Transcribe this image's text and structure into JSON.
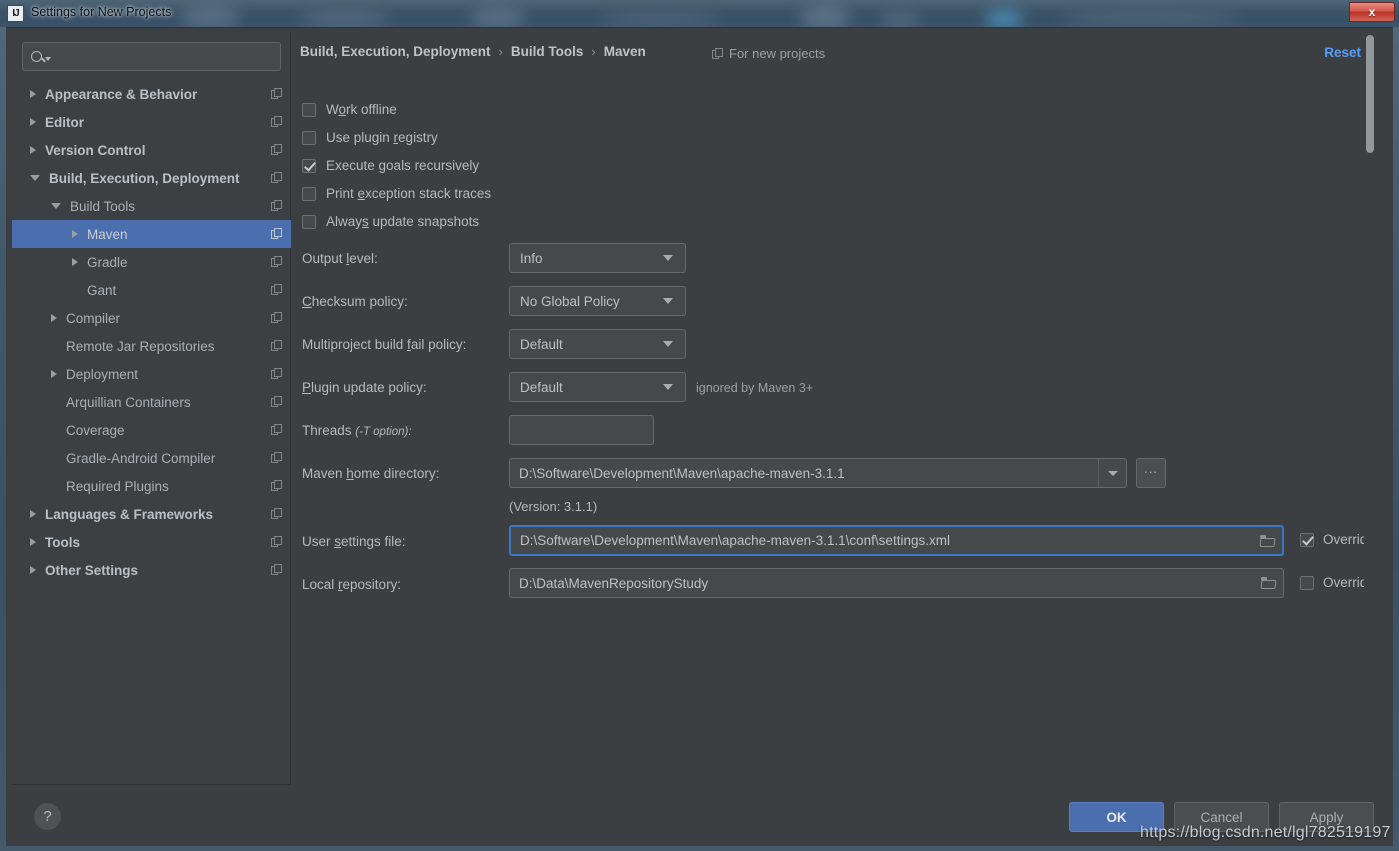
{
  "window": {
    "title": "Settings for New Projects",
    "app_icon": "IJ",
    "close_label": "x"
  },
  "sidebar": {
    "search": {
      "placeholder": "",
      "value": "",
      "icon": "search-icon"
    },
    "tree": [
      {
        "label": "Appearance & Behavior",
        "indent": 0,
        "state": "collapsed",
        "bold": true,
        "selected": false
      },
      {
        "label": "Editor",
        "indent": 0,
        "state": "collapsed",
        "bold": true,
        "selected": false
      },
      {
        "label": "Version Control",
        "indent": 0,
        "state": "collapsed",
        "bold": true,
        "selected": false
      },
      {
        "label": "Build, Execution, Deployment",
        "indent": 0,
        "state": "expanded",
        "bold": true,
        "selected": false
      },
      {
        "label": "Build Tools",
        "indent": 1,
        "state": "expanded",
        "bold": false,
        "selected": false
      },
      {
        "label": "Maven",
        "indent": 2,
        "state": "collapsed",
        "bold": false,
        "selected": true
      },
      {
        "label": "Gradle",
        "indent": 2,
        "state": "collapsed",
        "bold": false,
        "selected": false
      },
      {
        "label": "Gant",
        "indent": 2,
        "state": "leaf",
        "bold": false,
        "selected": false
      },
      {
        "label": "Compiler",
        "indent": 1,
        "state": "collapsed",
        "bold": false,
        "selected": false
      },
      {
        "label": "Remote Jar Repositories",
        "indent": 1,
        "state": "leaf",
        "bold": false,
        "selected": false
      },
      {
        "label": "Deployment",
        "indent": 1,
        "state": "collapsed",
        "bold": false,
        "selected": false
      },
      {
        "label": "Arquillian Containers",
        "indent": 1,
        "state": "leaf",
        "bold": false,
        "selected": false
      },
      {
        "label": "Coverage",
        "indent": 1,
        "state": "leaf",
        "bold": false,
        "selected": false
      },
      {
        "label": "Gradle-Android Compiler",
        "indent": 1,
        "state": "leaf",
        "bold": false,
        "selected": false
      },
      {
        "label": "Required Plugins",
        "indent": 1,
        "state": "leaf",
        "bold": false,
        "selected": false
      },
      {
        "label": "Languages & Frameworks",
        "indent": 0,
        "state": "collapsed",
        "bold": true,
        "selected": false
      },
      {
        "label": "Tools",
        "indent": 0,
        "state": "collapsed",
        "bold": true,
        "selected": false
      },
      {
        "label": "Other Settings",
        "indent": 0,
        "state": "collapsed",
        "bold": true,
        "selected": false
      }
    ]
  },
  "content": {
    "breadcrumb": [
      "Build, Execution, Deployment",
      "Build Tools",
      "Maven"
    ],
    "breadcrumb_separator": "›",
    "for_new_projects": "For new projects",
    "reset_link": "Reset",
    "checkboxes": [
      {
        "label": "Work offline",
        "mnemonic": "o",
        "checked": false
      },
      {
        "label": "Use plugin registry",
        "mnemonic": "r",
        "checked": false
      },
      {
        "label": "Execute goals recursively",
        "mnemonic": "g",
        "checked": true
      },
      {
        "label": "Print exception stack traces",
        "mnemonic": "e",
        "checked": false
      },
      {
        "label": "Always update snapshots",
        "mnemonic": "s",
        "checked": false
      }
    ],
    "output_level": {
      "label": "Output level:",
      "mnemonic": "l",
      "value": "Info"
    },
    "checksum_policy": {
      "label": "Checksum policy:",
      "mnemonic": "C",
      "value": "No Global Policy"
    },
    "fail_policy": {
      "label": "Multiproject build fail policy:",
      "mnemonic": "f",
      "value": "Default"
    },
    "plugin_policy": {
      "label": "Plugin update policy:",
      "mnemonic": "P",
      "value": "Default",
      "hint": "ignored by Maven 3+"
    },
    "threads": {
      "label": "Threads",
      "label_italic": "(-T option):",
      "value": ""
    },
    "maven_home": {
      "label": "Maven home directory:",
      "mnemonic": "h",
      "value": "D:\\Software\\Development\\Maven\\apache-maven-3.1.1"
    },
    "version_text": "(Version: 3.1.1)",
    "user_settings": {
      "label": "User settings file:",
      "mnemonic": "s",
      "value": "D:\\Software\\Development\\Maven\\apache-maven-3.1.1\\conf\\settings.xml",
      "override": true,
      "override_label": "Override",
      "focused": true
    },
    "local_repo": {
      "label": "Local repository:",
      "mnemonic": "r",
      "value": "D:\\Data\\MavenRepositoryStudy",
      "override": false,
      "override_label": "Override",
      "focused": false
    },
    "browse_button": "..."
  },
  "footer": {
    "help": "?",
    "ok": "OK",
    "cancel": "Cancel",
    "apply": "Apply"
  },
  "watermark": "https://blog.csdn.net/lgl782519197",
  "colors": {
    "background": "#3c3f41",
    "sidebar": "#3c4043",
    "selection": "#4b6eaf",
    "accent_link": "#589df6",
    "field": "#45494a",
    "focus_border": "#3c77c7",
    "title_close": "#b83228"
  }
}
